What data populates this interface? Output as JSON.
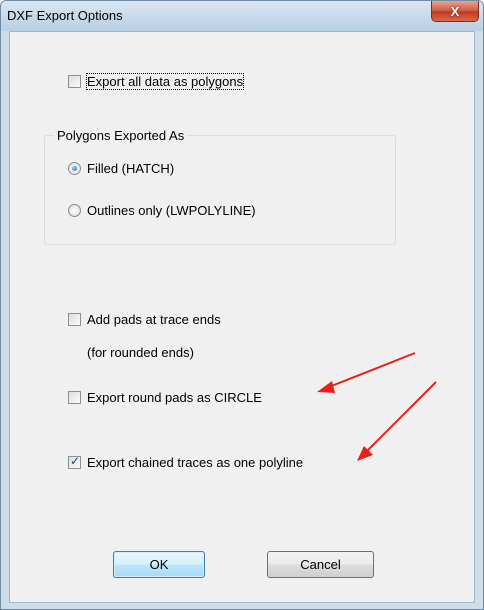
{
  "window": {
    "title": "DXF Export Options",
    "close_glyph": "X"
  },
  "options": {
    "export_all_polygons": {
      "label": "Export all data as polygons",
      "checked": false
    },
    "polygons_group": {
      "label": "Polygons Exported As",
      "filled": {
        "label": "Filled (HATCH)",
        "selected": true
      },
      "outlines": {
        "label": "Outlines only (LWPOLYLINE)",
        "selected": false
      }
    },
    "add_pads": {
      "label": "Add pads at trace ends",
      "checked": false,
      "note": "(for rounded ends)"
    },
    "round_pads_circle": {
      "label": "Export round pads as CIRCLE",
      "checked": false
    },
    "chained_traces": {
      "label": "Export chained traces as one polyline",
      "checked": true
    }
  },
  "buttons": {
    "ok": "OK",
    "cancel": "Cancel"
  },
  "annotations": {
    "arrow_color": "#e8201c"
  },
  "colors": {
    "dialog_bg": "#f0f0f0",
    "frame": "#cfdde9"
  }
}
